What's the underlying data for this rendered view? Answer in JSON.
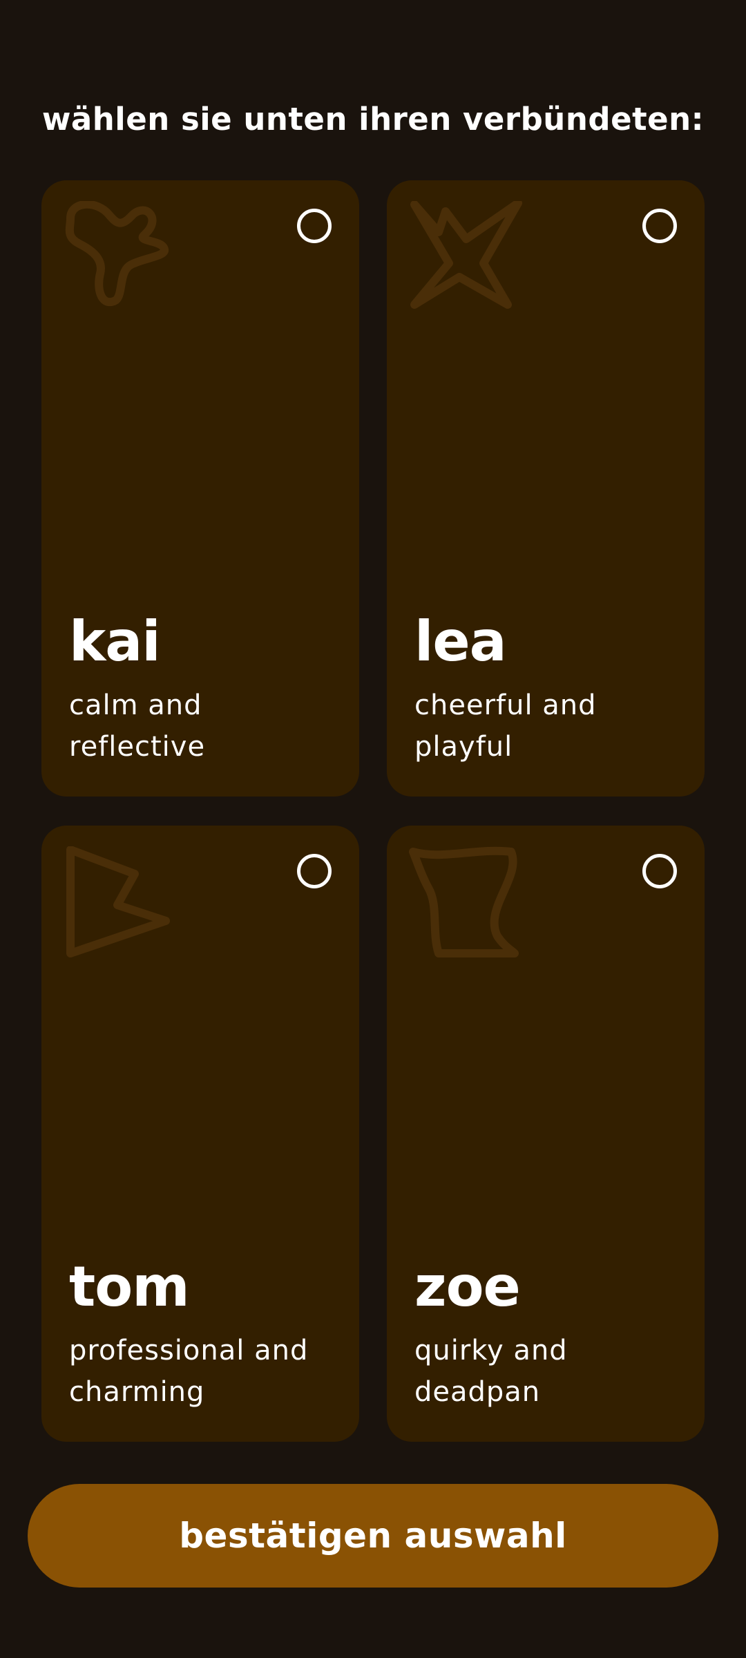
{
  "header": {
    "title": "wählen sie unten ihren verbündeten:"
  },
  "colors": {
    "background": "#1a130d",
    "card": "#331f00",
    "shape_stroke": "#4a2e08",
    "accent": "#8a5204",
    "text": "#ffffff"
  },
  "companions": [
    {
      "name": "kai",
      "description": "calm and reflective",
      "icon": "blob-shape-icon",
      "selected": false
    },
    {
      "name": "lea",
      "description": "cheerful and playful",
      "icon": "star-shape-icon",
      "selected": false
    },
    {
      "name": "tom",
      "description": "professional and charming",
      "icon": "triangle-shape-icon",
      "selected": false
    },
    {
      "name": "zoe",
      "description": "quirky and deadpan",
      "icon": "wavy-square-shape-icon",
      "selected": false
    }
  ],
  "footer": {
    "confirm_label": "bestätigen auswahl"
  }
}
